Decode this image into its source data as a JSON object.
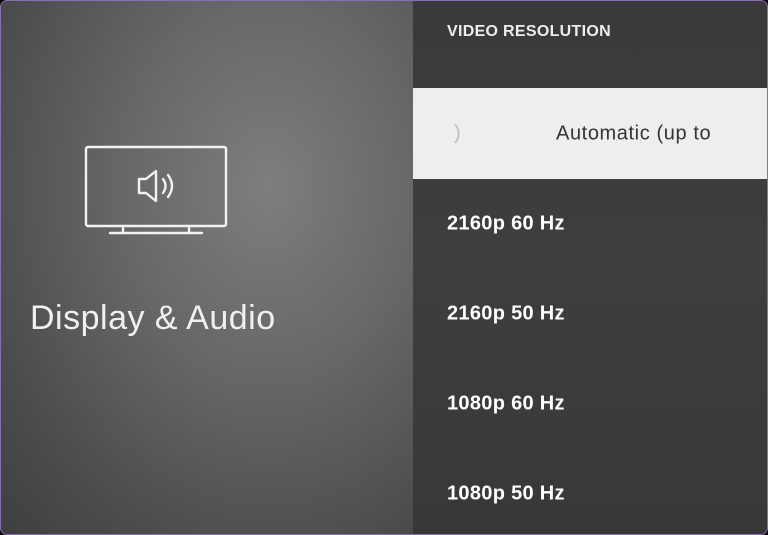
{
  "category": {
    "title": "Display & Audio",
    "icon": "tv-speaker-icon"
  },
  "video_resolution": {
    "header": "VIDEO RESOLUTION",
    "selected_marquee_tail": ")",
    "options": [
      {
        "label": "Automatic (up to",
        "selected": true
      },
      {
        "label": "2160p 60 Hz",
        "selected": false
      },
      {
        "label": "2160p 50 Hz",
        "selected": false
      },
      {
        "label": "1080p 60 Hz",
        "selected": false
      },
      {
        "label": "1080p 50 Hz",
        "selected": false
      }
    ]
  },
  "colors": {
    "selected_background": "#eeeeee",
    "selected_text": "#333333",
    "unselected_text": "#ffffff",
    "panel_background": "#3d3d3d"
  }
}
